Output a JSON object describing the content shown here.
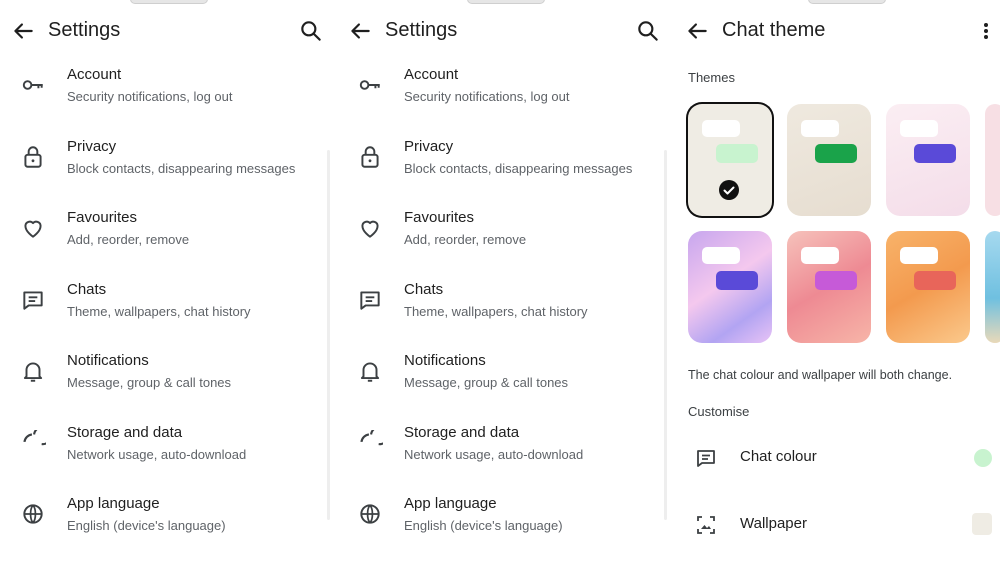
{
  "settings_screen": {
    "title": "Settings",
    "items": [
      {
        "label": "Account",
        "sub": "Security notifications, log out",
        "icon": "key-icon"
      },
      {
        "label": "Privacy",
        "sub": "Block contacts, disappearing messages",
        "icon": "lock-icon"
      },
      {
        "label": "Favourites",
        "sub": "Add, reorder, remove",
        "icon": "heart-icon"
      },
      {
        "label": "Chats",
        "sub": "Theme, wallpapers, chat history",
        "icon": "chat-icon"
      },
      {
        "label": "Notifications",
        "sub": "Message, group & call tones",
        "icon": "bell-icon"
      },
      {
        "label": "Storage and data",
        "sub": "Network usage, auto-download",
        "icon": "storage-circle-icon"
      },
      {
        "label": "App language",
        "sub": "English (device's language)",
        "icon": "globe-icon"
      }
    ]
  },
  "chat_theme_screen": {
    "title": "Chat theme",
    "themes_label": "Themes",
    "themes": [
      {
        "name": "light-plain",
        "selected": true,
        "bubble": "#c8f3cf",
        "bg": "#efece4"
      },
      {
        "name": "beige-green",
        "selected": false,
        "bubble": "#1aa34a",
        "bg": "#ece6dc"
      },
      {
        "name": "pink-purple",
        "selected": false,
        "bubble": "#5a4ad8",
        "bg": "#f8e6ef"
      },
      {
        "name": "holo-purple",
        "selected": false,
        "bubble": "#5a4ad8",
        "bg": "#d8b8f0"
      },
      {
        "name": "floral-pink",
        "selected": false,
        "bubble": "#c65ad8",
        "bg": "#f3b6b6"
      },
      {
        "name": "orange-swirl",
        "selected": false,
        "bubble": "#e8655a",
        "bg": "#f6a866"
      }
    ],
    "note": "The chat colour and wallpaper will both change.",
    "customise_label": "Customise",
    "customise_items": [
      {
        "label": "Chat colour",
        "icon": "chat-icon",
        "swatch": "#c8f3cf"
      },
      {
        "label": "Wallpaper",
        "icon": "wallpaper-icon",
        "swatch": "#efece4"
      }
    ]
  },
  "colors": {
    "text": "#1f1f1f",
    "subtext": "#5f6368",
    "icon": "#3c4043"
  }
}
